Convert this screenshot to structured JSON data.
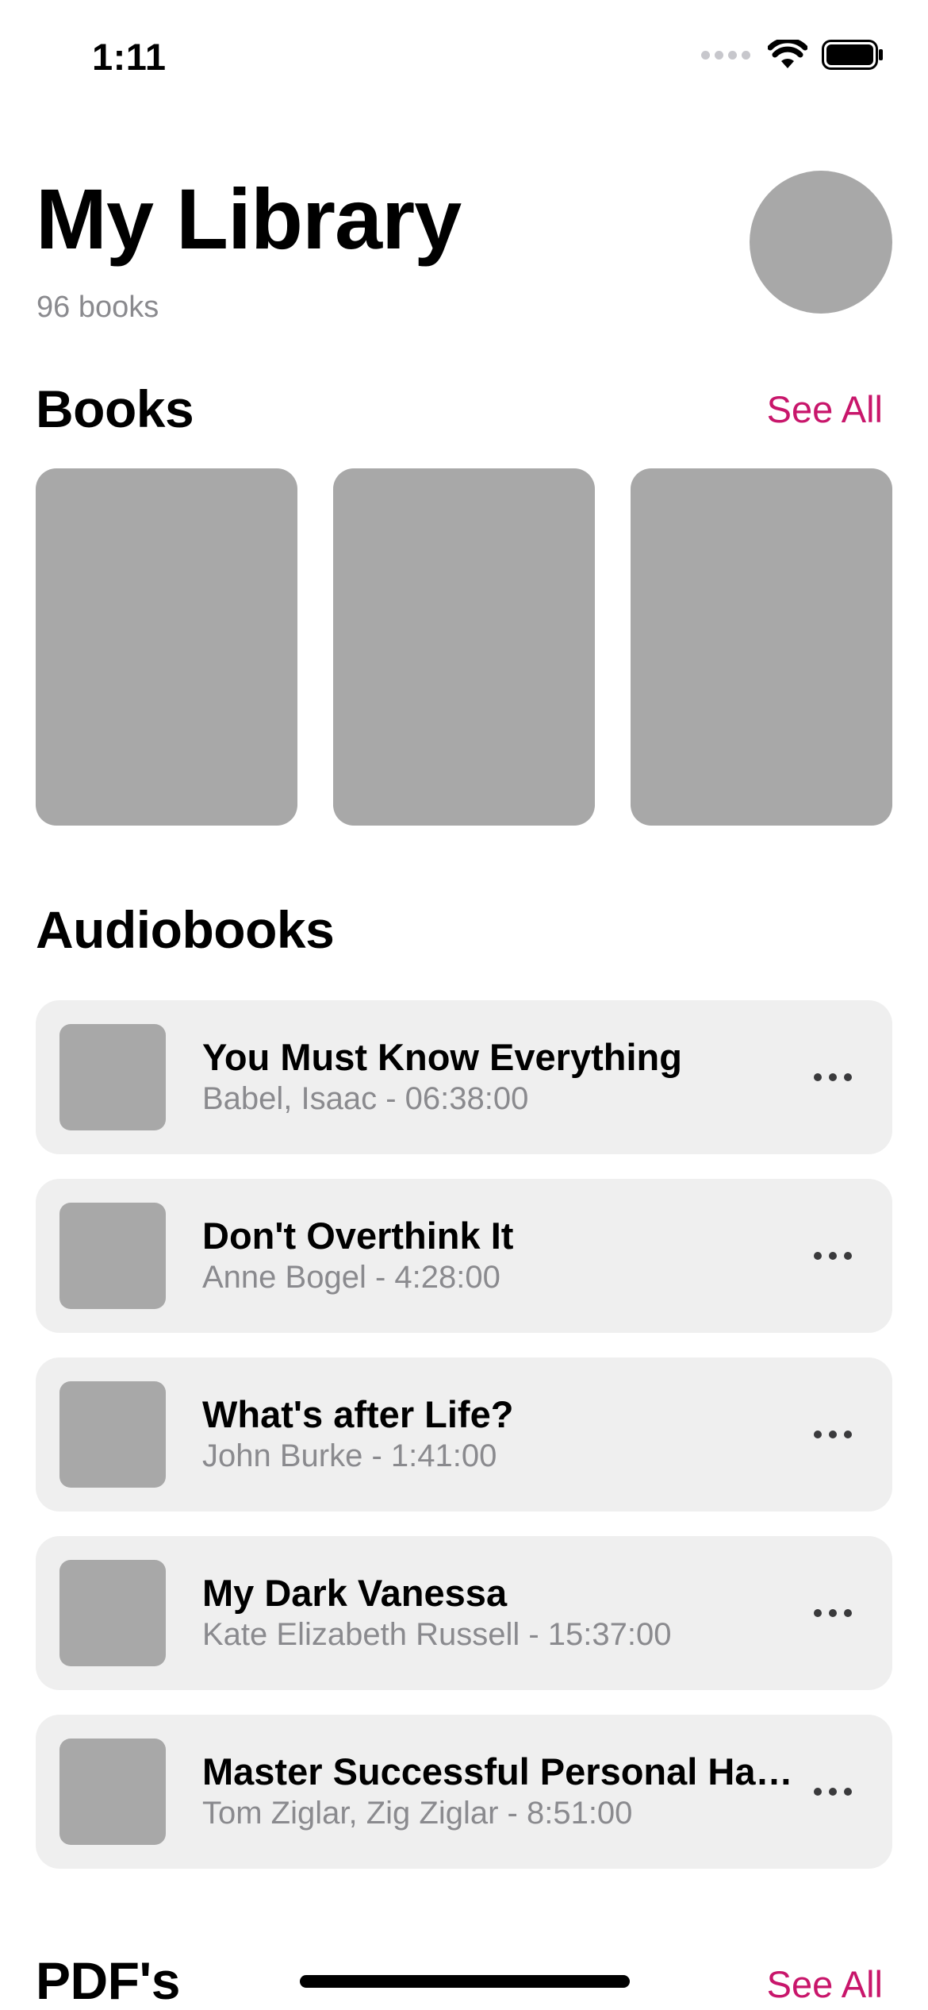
{
  "status_bar": {
    "time": "1:11"
  },
  "header": {
    "title": "My Library",
    "subtitle": "96 books"
  },
  "books": {
    "title": "Books",
    "see_all": "See All"
  },
  "audiobooks": {
    "title": "Audiobooks",
    "items": [
      {
        "title": "You Must Know Everything",
        "meta": "Babel, Isaac - 06:38:00"
      },
      {
        "title": "Don't Overthink It",
        "meta": "Anne Bogel - 4:28:00"
      },
      {
        "title": "What's after Life?",
        "meta": "John Burke - 1:41:00"
      },
      {
        "title": "My Dark Vanessa",
        "meta": "Kate Elizabeth Russell - 15:37:00"
      },
      {
        "title": "Master Successful Personal Habits",
        "meta": "Tom Ziglar, Zig Ziglar - 8:51:00"
      }
    ]
  },
  "pdfs": {
    "title": "PDF's",
    "see_all": "See All"
  },
  "icons": {
    "wifi": "wifi-icon",
    "battery": "battery-icon",
    "more": "more-icon",
    "cellular": "signal-icon"
  },
  "colors": {
    "accent": "#c8166b",
    "placeholder": "#a8a8a8",
    "row_background": "#efefef",
    "secondary_text": "#8a8a8e"
  }
}
